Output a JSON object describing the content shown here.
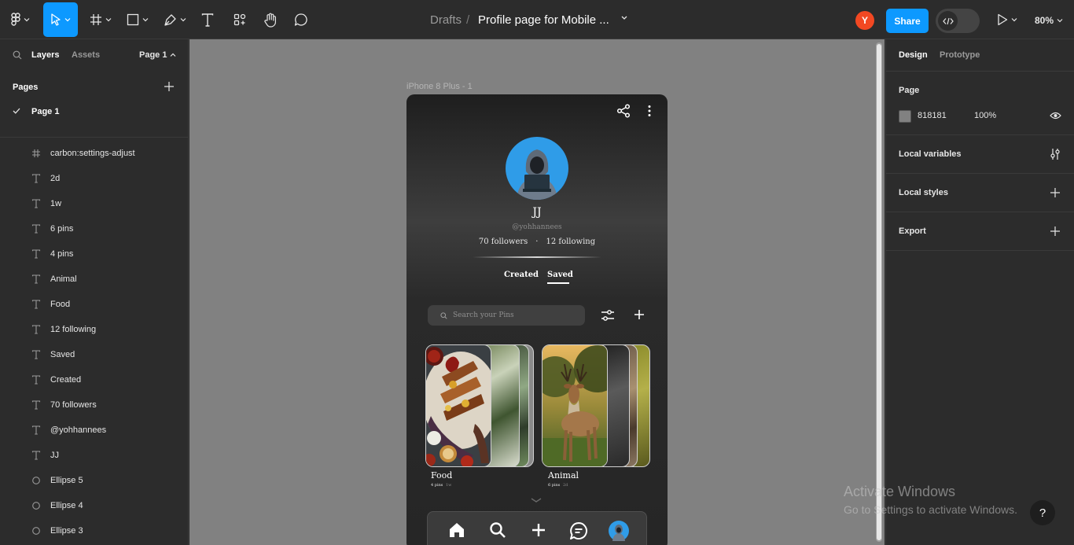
{
  "toolbar": {
    "breadcrumb_drafts": "Drafts",
    "breadcrumb_sep": "/",
    "file_name": "Profile page for Mobile ...",
    "user_initial": "Y",
    "share_label": "Share",
    "zoom_label": "80%"
  },
  "left_panel": {
    "tab_layers": "Layers",
    "tab_assets": "Assets",
    "page_selector": "Page 1",
    "pages_title": "Pages",
    "pages": [
      {
        "label": "Page 1",
        "selected": true
      }
    ],
    "layers": [
      {
        "label": "carbon:settings-adjust",
        "kind": "frame-icon"
      },
      {
        "label": "2d",
        "kind": "text-icon"
      },
      {
        "label": "1w",
        "kind": "text-icon"
      },
      {
        "label": "6 pins",
        "kind": "text-icon"
      },
      {
        "label": "4 pins",
        "kind": "text-icon"
      },
      {
        "label": "Animal",
        "kind": "text-icon"
      },
      {
        "label": "Food",
        "kind": "text-icon"
      },
      {
        "label": "12 following",
        "kind": "text-icon"
      },
      {
        "label": "Saved",
        "kind": "text-icon"
      },
      {
        "label": "Created",
        "kind": "text-icon"
      },
      {
        "label": "70 followers",
        "kind": "text-icon"
      },
      {
        "label": "@yohhannees",
        "kind": "text-icon"
      },
      {
        "label": "JJ",
        "kind": "text-icon"
      },
      {
        "label": "Ellipse 5",
        "kind": "ellipse-icon"
      },
      {
        "label": "Ellipse 4",
        "kind": "ellipse-icon"
      },
      {
        "label": "Ellipse 3",
        "kind": "ellipse-icon"
      }
    ]
  },
  "canvas": {
    "background": "#818181",
    "frame_label": "iPhone 8 Plus - 1"
  },
  "phone": {
    "name": "JJ",
    "handle": "@yohhannees",
    "followers": "70 followers",
    "dot": "·",
    "following": "12 following",
    "tab_created": "Created",
    "tab_saved": "Saved",
    "search_placeholder": "Search your Pins",
    "boards": [
      {
        "title": "Food",
        "pins": "4 pins",
        "age": "1w"
      },
      {
        "title": "Animal",
        "pins": "6 pins",
        "age": "2d"
      }
    ]
  },
  "right_panel": {
    "tab_design": "Design",
    "tab_prototype": "Prototype",
    "page_label": "Page",
    "page_color": "818181",
    "page_opacity": "100%",
    "local_variables": "Local variables",
    "local_styles": "Local styles",
    "export": "Export"
  },
  "watermark": {
    "line1": "Activate Windows",
    "line2": "Go to Settings to activate Windows."
  },
  "help_label": "?",
  "colors": {
    "accent": "#0d99ff",
    "avatar": "#f24822",
    "panel": "#2c2c2c"
  }
}
